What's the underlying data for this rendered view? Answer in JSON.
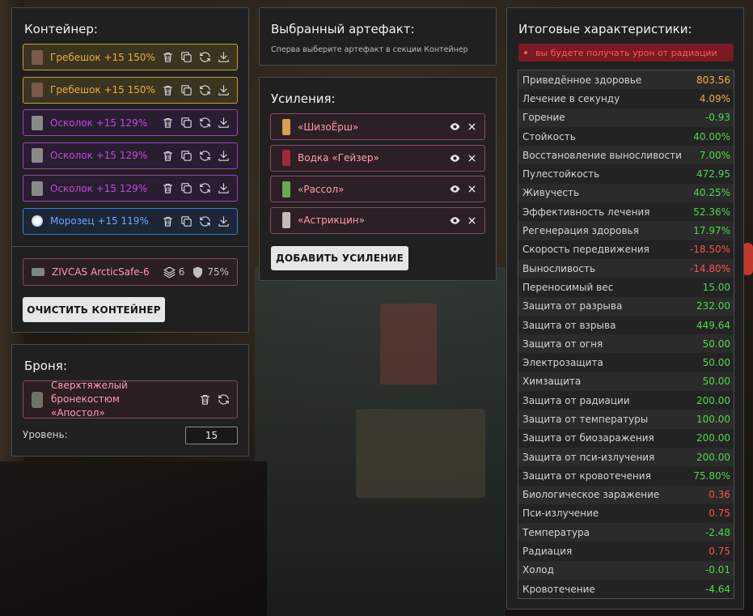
{
  "colors": {
    "panel_bg": "#202020",
    "gold": "#e8b13a",
    "purple": "#c04ad8",
    "blue": "#6aa8ff",
    "positive": "#4cd94c",
    "negative": "#ff4f4f",
    "warning_bg": "#8e1c24"
  },
  "container": {
    "title": "Контейнер:",
    "slots": [
      {
        "name": "Гребешок +15 150%",
        "rarity": "gold",
        "icon": "crest-artifact-icon"
      },
      {
        "name": "Гребешок +15 150%",
        "rarity": "gold",
        "icon": "crest-artifact-icon"
      },
      {
        "name": "Осколок +15 129%",
        "rarity": "purple",
        "icon": "shard-artifact-icon"
      },
      {
        "name": "Осколок +15 129%",
        "rarity": "purple",
        "icon": "shard-artifact-icon"
      },
      {
        "name": "Осколок +15 129%",
        "rarity": "purple",
        "icon": "shard-artifact-icon"
      },
      {
        "name": "Морозец +15 119%",
        "rarity": "blue",
        "icon": "frost-artifact-icon"
      }
    ],
    "case": {
      "name": "ZIVCAS ArcticSafe-6",
      "slots_count": "6",
      "protection": "75%"
    },
    "clear_button": "ОЧИСТИТЬ КОНТЕЙНЕР"
  },
  "armor": {
    "title": "Броня:",
    "name_line1": "Сверхтяжелый бронекостюм",
    "name_line2": "«Апостол»",
    "level_label": "Уровень:",
    "level_value": "15"
  },
  "selected": {
    "title": "Выбранный артефакт:",
    "hint": "Сперва выберите артефакт в секции Контейнер"
  },
  "boosts": {
    "title": "Усиления:",
    "items": [
      {
        "name": "«ШизоЁрш»",
        "icon": "syringe-icon"
      },
      {
        "name": "Водка «Гейзер»",
        "icon": "bottle-icon"
      },
      {
        "name": "«Рассол»",
        "icon": "jar-icon"
      },
      {
        "name": "«Астрикцин»",
        "icon": "injector-icon"
      }
    ],
    "add_button": "ДОБАВИТЬ УСИЛЕНИЕ"
  },
  "summary": {
    "title": "Итоговые характеристики:",
    "warning": "вы будете получать урон от радиации",
    "stats": [
      {
        "label": "Приведённое здоровье",
        "value": "803.56",
        "tone": "neu"
      },
      {
        "label": "Лечение в секунду",
        "value": "4.09%",
        "tone": "neu"
      },
      {
        "label": "Горение",
        "value": "-0.93",
        "tone": "pos"
      },
      {
        "label": "Стойкость",
        "value": "40.00%",
        "tone": "pos"
      },
      {
        "label": "Восстановление выносливости",
        "value": "7.00%",
        "tone": "pos"
      },
      {
        "label": "Пулестойкость",
        "value": "472.95",
        "tone": "pos"
      },
      {
        "label": "Живучесть",
        "value": "40.25%",
        "tone": "pos"
      },
      {
        "label": "Эффективность лечения",
        "value": "52.36%",
        "tone": "pos"
      },
      {
        "label": "Регенерация здоровья",
        "value": "17.97%",
        "tone": "pos"
      },
      {
        "label": "Скорость передвижения",
        "value": "-18.50%",
        "tone": "neg"
      },
      {
        "label": "Выносливость",
        "value": "-14.80%",
        "tone": "neg"
      },
      {
        "label": "Переносимый вес",
        "value": "15.00",
        "tone": "pos"
      },
      {
        "label": "Защита от разрыва",
        "value": "232.00",
        "tone": "pos"
      },
      {
        "label": "Защита от взрыва",
        "value": "449.64",
        "tone": "pos"
      },
      {
        "label": "Защита от огня",
        "value": "50.00",
        "tone": "pos"
      },
      {
        "label": "Электрозащита",
        "value": "50.00",
        "tone": "pos"
      },
      {
        "label": "Химзащита",
        "value": "50.00",
        "tone": "pos"
      },
      {
        "label": "Защита от радиации",
        "value": "200.00",
        "tone": "pos"
      },
      {
        "label": "Защита от температуры",
        "value": "100.00",
        "tone": "pos"
      },
      {
        "label": "Защита от биозаражения",
        "value": "200.00",
        "tone": "pos"
      },
      {
        "label": "Защита от пси-излучения",
        "value": "200.00",
        "tone": "pos"
      },
      {
        "label": "Защита от кровотечения",
        "value": "75.80%",
        "tone": "pos"
      },
      {
        "label": "Биологическое заражение",
        "value": "0.36",
        "tone": "neg"
      },
      {
        "label": "Пси-излучение",
        "value": "0.75",
        "tone": "neg"
      },
      {
        "label": "Температура",
        "value": "-2.48",
        "tone": "pos"
      },
      {
        "label": "Радиация",
        "value": "0.75",
        "tone": "neg"
      },
      {
        "label": "Холод",
        "value": "-0.01",
        "tone": "pos"
      },
      {
        "label": "Кровотечение",
        "value": "-4.64",
        "tone": "pos"
      }
    ]
  }
}
